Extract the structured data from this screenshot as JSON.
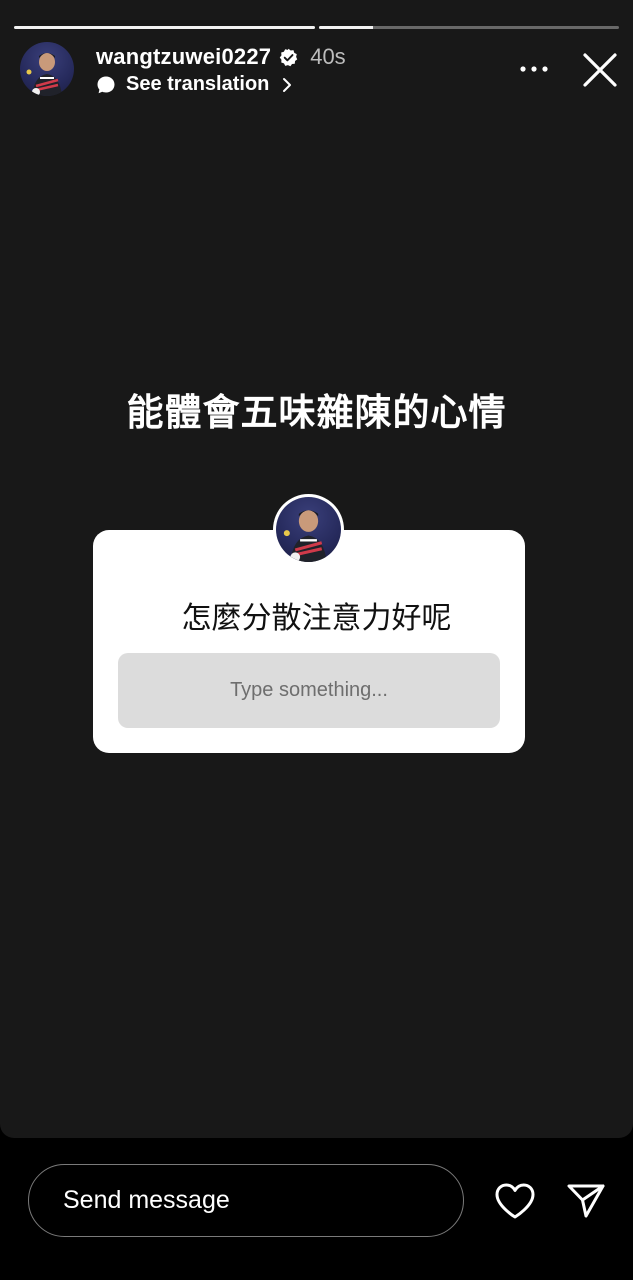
{
  "progress": {
    "segments": [
      1.0,
      0.18
    ]
  },
  "header": {
    "username": "wangtzuwei0227",
    "verified": true,
    "time_ago": "40s",
    "translate_label": "See translation",
    "icons": {
      "avatar": "profile-photo",
      "verified": "verified-badge-icon",
      "translate": "speech-bubble-icon",
      "chevron": "chevron-right-icon",
      "more": "more-dots-icon",
      "close": "close-icon"
    }
  },
  "story": {
    "headline": "能體會五味雜陳的心情",
    "question_sticker": {
      "question": "怎麼分散注意力好呢",
      "input_placeholder": "Type something..."
    }
  },
  "footer": {
    "message_placeholder": "Send message",
    "icons": {
      "like": "heart-icon",
      "share": "send-paper-plane-icon"
    }
  },
  "colors": {
    "background": "#000000",
    "story_bg": "#181818",
    "sticker_bg": "#ffffff",
    "input_bg": "#dcdcdc"
  }
}
